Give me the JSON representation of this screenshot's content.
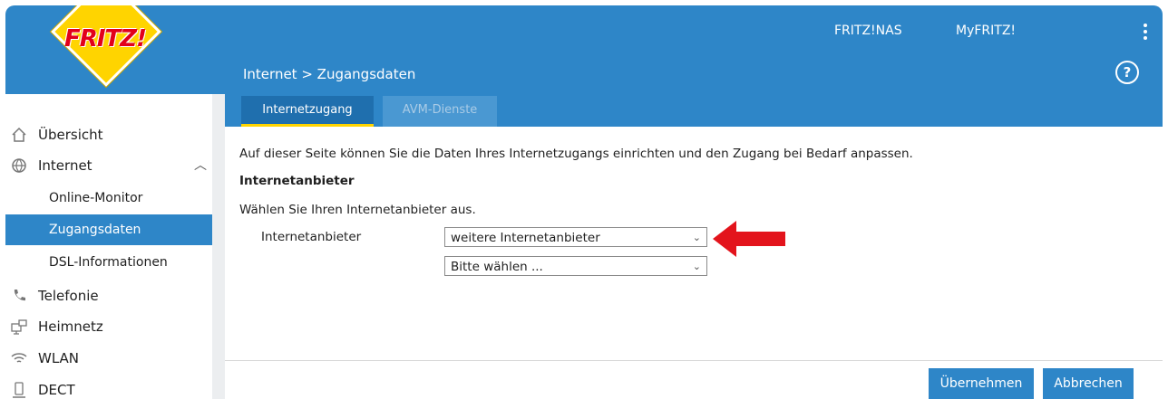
{
  "brand": {
    "logo_text": "FRITZ!"
  },
  "header": {
    "links": [
      "FRITZ!NAS",
      "MyFRITZ!"
    ],
    "breadcrumb": "Internet > Zugangsdaten",
    "help": "?"
  },
  "tabs": [
    {
      "label": "Internetzugang",
      "active": true
    },
    {
      "label": "AVM-Dienste",
      "active": false
    }
  ],
  "sidebar": {
    "items": [
      {
        "label": "Übersicht",
        "icon": "home-icon"
      },
      {
        "label": "Internet",
        "icon": "globe-icon",
        "expanded": true
      },
      {
        "label": "Online-Monitor",
        "sub": true
      },
      {
        "label": "Zugangsdaten",
        "sub": true,
        "selected": true
      },
      {
        "label": "DSL-Informationen",
        "sub": true
      },
      {
        "label": "Telefonie",
        "icon": "phone-icon"
      },
      {
        "label": "Heimnetz",
        "icon": "network-icon"
      },
      {
        "label": "WLAN",
        "icon": "wifi-icon"
      },
      {
        "label": "DECT",
        "icon": "dect-phone-icon"
      }
    ]
  },
  "main": {
    "intro": "Auf dieser Seite können Sie die Daten Ihres Internetzugangs einrichten und den Zugang bei Bedarf anpassen.",
    "section_title": "Internetanbieter",
    "choose_text": "Wählen Sie Ihren Internetanbieter aus.",
    "field_label": "Internetanbieter",
    "provider_select": "weitere Internetanbieter",
    "sub_select": "Bitte wählen ..."
  },
  "buttons": {
    "apply": "Übernehmen",
    "cancel": "Abbrechen"
  },
  "colors": {
    "accent": "#2e86c8",
    "logo_red": "#e2001a",
    "logo_yellow": "#ffd400",
    "arrow": "#e3141c"
  }
}
